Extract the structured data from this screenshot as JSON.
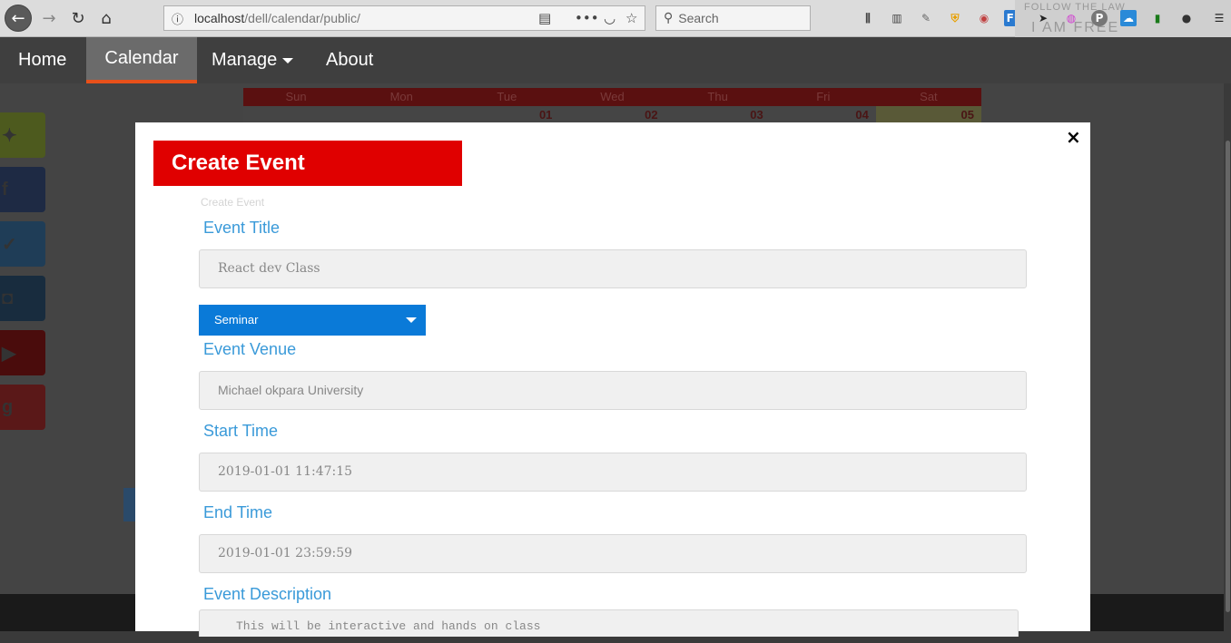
{
  "browser": {
    "url_host": "localhost",
    "url_path": "/dell/calendar/public/",
    "search_placeholder": "Search",
    "banner_line1": "FOLLOW THE LAW",
    "banner_line2": "I AM FREE"
  },
  "nav": {
    "home": "Home",
    "calendar": "Calendar",
    "manage": "Manage",
    "about": "About"
  },
  "calendar": {
    "days": [
      "Sun",
      "Mon",
      "Tue",
      "Wed",
      "Thu",
      "Fri",
      "Sat"
    ],
    "first_row": [
      "",
      "",
      "01",
      "02",
      "03",
      "04",
      "05"
    ]
  },
  "modal": {
    "title": "Create Event",
    "breadcrumb": "Create Event",
    "close_symbol": "×",
    "event_title_label": "Event Title",
    "event_title_value": "React dev Class",
    "event_type_selected": "Seminar",
    "event_venue_label": "Event Venue",
    "event_venue_value": "Michael okpara University",
    "start_time_label": "Start Time",
    "start_time_value": "2019-01-01 11:47:15",
    "end_time_label": "End Time",
    "end_time_value": "2019-01-01 23:59:59",
    "description_label": "Event Description",
    "description_value": "This will be interactive and hands on class"
  },
  "colors": {
    "modal_title_bg": "#e00000",
    "label_blue": "#3a9ad9",
    "select_bg": "#0a7ad8",
    "active_tab_underline": "#e8501a"
  }
}
